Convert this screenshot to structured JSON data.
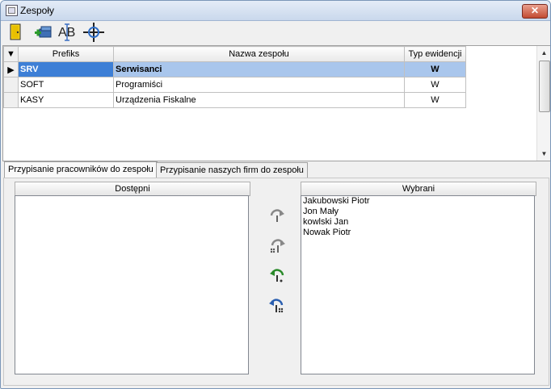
{
  "window": {
    "title": "Zespoły",
    "close_label": "✕"
  },
  "toolbar": {
    "icons": [
      "door-exit-icon",
      "add-record-icon",
      "rename-ab-icon",
      "crosshair-icon"
    ],
    "rename_text": "AB"
  },
  "grid": {
    "columns": [
      "Prefiks",
      "Nazwa zespołu",
      "Typ ewidencji"
    ],
    "rows": [
      {
        "prefix": "SRV",
        "name": "Serwisanci",
        "type": "W",
        "selected": true
      },
      {
        "prefix": "SOFT",
        "name": "Programiści",
        "type": "W",
        "selected": false
      },
      {
        "prefix": "KASY",
        "name": "Urządzenia Fiskalne",
        "type": "W",
        "selected": false
      }
    ],
    "row_indicator": "▶",
    "header_indicator": "▼"
  },
  "tabs": [
    {
      "label": "Przypisanie pracowników do zespołu",
      "active": true
    },
    {
      "label": "Przypisanie naszych firm do zespołu",
      "active": false
    }
  ],
  "assign": {
    "available_header": "Dostępni",
    "selected_header": "Wybrani",
    "available_items": [],
    "selected_items": [
      "Jakubowski Piotr",
      "Jon Mały",
      "kowlski Jan",
      "Nowak Piotr"
    ]
  },
  "colors": {
    "selection_dark": "#3d7fd6",
    "selection_light": "#a9c6ec",
    "arrow_gray": "#888888",
    "arrow_green": "#2a8a2a",
    "arrow_blue": "#2a5fb0"
  }
}
